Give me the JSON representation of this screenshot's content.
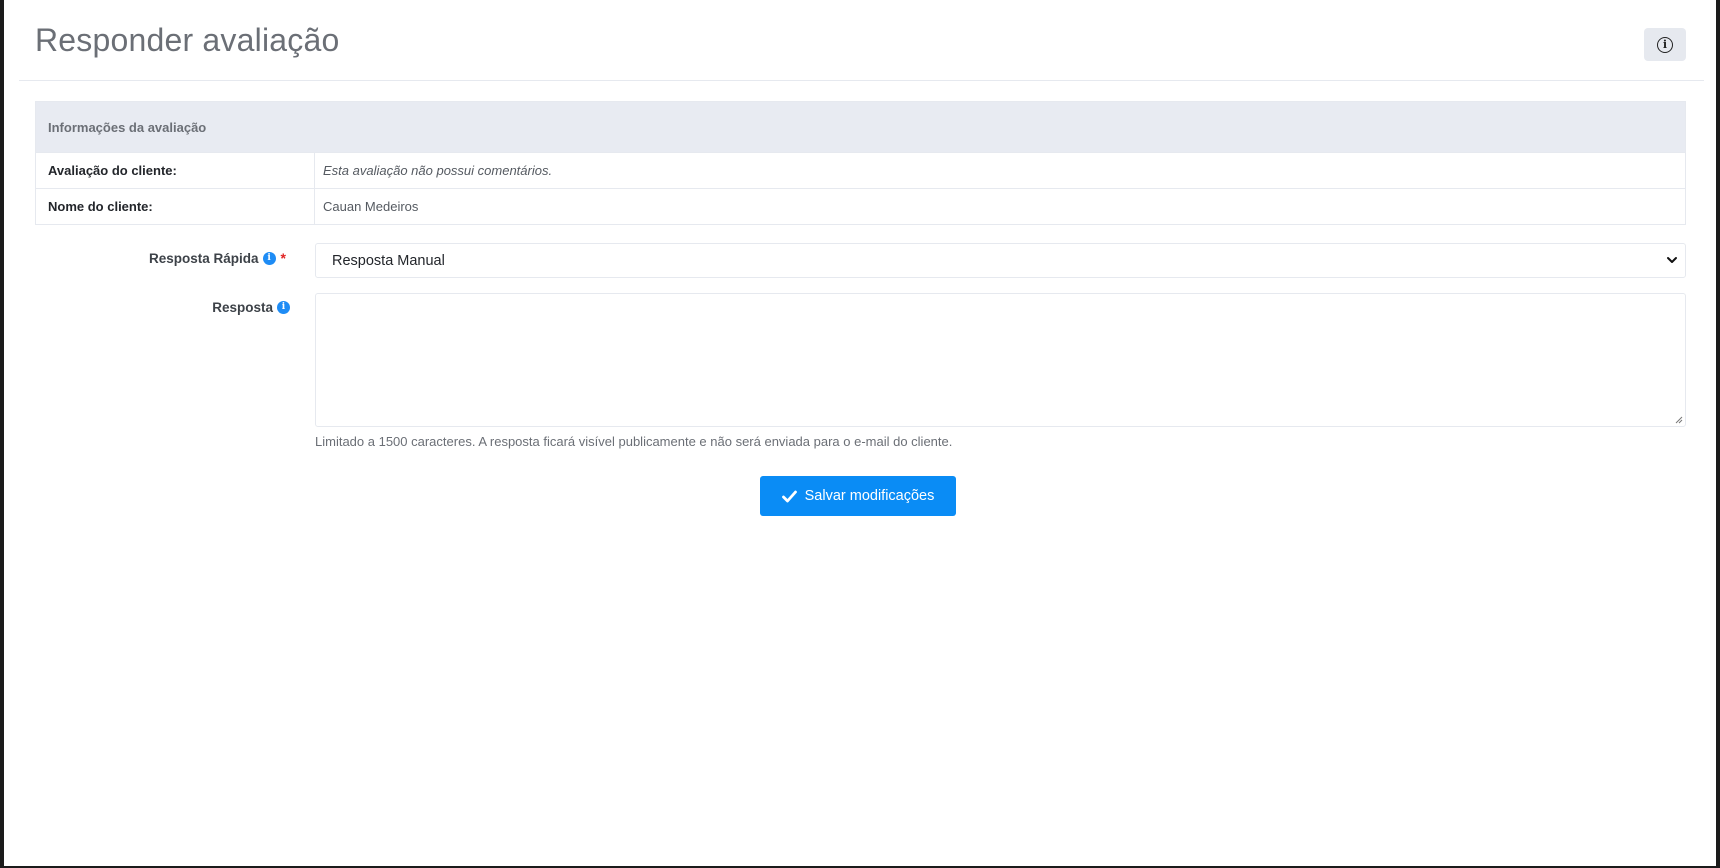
{
  "header": {
    "title": "Responder avaliação",
    "info_button_icon": "info-circle-icon"
  },
  "review_info": {
    "heading": "Informações da avaliação",
    "rows": [
      {
        "label": "Avaliação do cliente:",
        "value": "Esta avaliação não possui comentários."
      },
      {
        "label": "Nome do cliente:",
        "value": "Cauan Medeiros"
      }
    ]
  },
  "form": {
    "quick_reply": {
      "label": "Resposta Rápida",
      "required_mark": "*",
      "selected": "Resposta Manual",
      "help_icon": "info-icon"
    },
    "reply": {
      "label": "Resposta",
      "value": "",
      "hint": "Limitado a 1500 caracteres. A resposta ficará visível publicamente e não será enviada para o e-mail do cliente.",
      "help_icon": "info-icon"
    },
    "save_button": {
      "label": "Salvar modificações",
      "icon": "check-icon"
    }
  },
  "colors": {
    "accent": "#0a8cf5",
    "table_header_bg": "#e8ebf2",
    "required": "#e02424"
  }
}
